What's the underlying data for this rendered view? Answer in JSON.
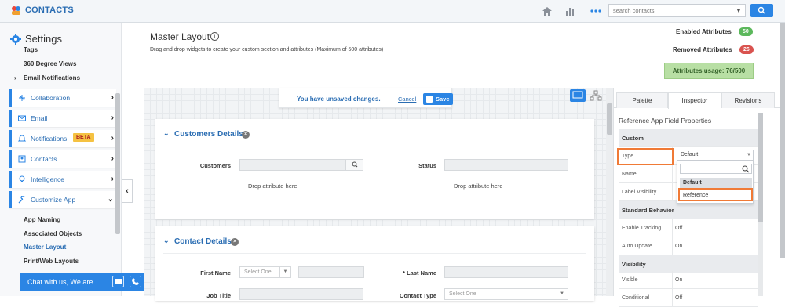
{
  "app": {
    "title": "CONTACTS",
    "search_placeholder": "search contacts"
  },
  "sidebar": {
    "title": "Settings",
    "top_links": [
      "Tags",
      "360 Degree Views"
    ],
    "email_notifications": "Email Notifications",
    "items": [
      {
        "label": "Collaboration",
        "icon": "collaboration-icon"
      },
      {
        "label": "Email",
        "icon": "email-icon"
      },
      {
        "label": "Notifications",
        "icon": "bell-icon",
        "badge": "BETA"
      },
      {
        "label": "Contacts",
        "icon": "contacts-icon"
      },
      {
        "label": "Intelligence",
        "icon": "bulb-icon"
      },
      {
        "label": "Customize App",
        "icon": "wrench-icon"
      }
    ],
    "sub_items": [
      "App Naming",
      "Associated Objects",
      "Master Layout",
      "Print/Web Layouts"
    ]
  },
  "chat": {
    "label": "Chat with us, We are ..."
  },
  "main": {
    "title": "Master Layout",
    "subtitle": "Drag and drop widgets to create your custom section and attributes (Maximum of 500 attributes)",
    "enabled_label": "Enabled Attributes",
    "enabled_count": "50",
    "removed_label": "Removed Attributes",
    "removed_count": "26",
    "usage": "Attributes usage: 76/500",
    "unsaved": {
      "message": "You have unsaved changes.",
      "cancel": "Cancel",
      "save": "Save"
    },
    "sections": [
      {
        "title": "Customers Details",
        "fields": [
          {
            "label": "Customers"
          },
          {
            "label": "Status"
          }
        ],
        "drop": "Drop attribute here"
      },
      {
        "title": "Contact Details",
        "fields": [
          {
            "label": "First Name",
            "select": "Select One"
          },
          {
            "label": "* Last Name",
            "required": "*",
            "text": "Last Name"
          },
          {
            "label": "Job Title"
          },
          {
            "label": "Contact Type",
            "select": "Select One"
          }
        ]
      }
    ]
  },
  "panel": {
    "tabs": [
      "Palette",
      "Inspector",
      "Revisions"
    ],
    "active_tab": "Inspector",
    "title": "Reference App Field Properties",
    "groups": [
      {
        "header": "Custom",
        "rows": [
          {
            "key": "Type",
            "value": "Default"
          },
          {
            "key": "Name",
            "value": ""
          },
          {
            "key": "Label Visibility",
            "value": ""
          }
        ]
      },
      {
        "header": "Standard Behavior",
        "rows": [
          {
            "key": "Enable Tracking",
            "value": "Off"
          },
          {
            "key": "Auto Update",
            "value": "On"
          }
        ]
      },
      {
        "header": "Visibility",
        "rows": [
          {
            "key": "Visible",
            "value": "On"
          },
          {
            "key": "Conditional",
            "value": "Off"
          }
        ]
      }
    ],
    "dropdown": {
      "value": "Default",
      "options": [
        "Default",
        "Reference"
      ]
    }
  },
  "colors": {
    "accent": "#2b85e4",
    "green_badge": "#5cb85c",
    "red_badge": "#d9534f",
    "highlight": "#f07a36"
  }
}
